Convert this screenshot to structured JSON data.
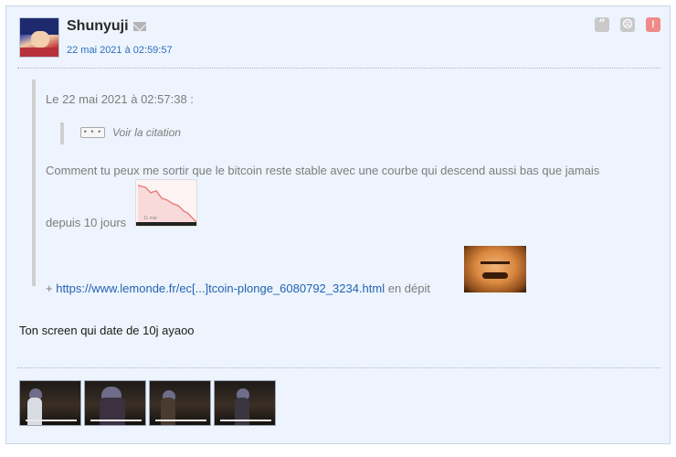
{
  "post": {
    "author": "Shunyuji",
    "date": "22 mai 2021 à 02:59:57",
    "actions": [
      "quote-icon",
      "sad-face-icon",
      "alert-icon"
    ],
    "quote": {
      "header": "Le 22 mai 2021 à 02:57:38 :",
      "nested_toggle": "• • •",
      "nested_label": "Voir la citation",
      "text_line1": "Comment tu peux me sortir que le bitcoin reste stable avec une courbe qui descend aussi bas que jamais",
      "text_line2": "depuis 10 jours",
      "chart_tick": "11 mai",
      "link_prefix": "+",
      "link_text": "https://www.lemonde.fr/ec[...]tcoin-plonge_6080792_3234.html",
      "link_suffix": "en dépit"
    },
    "reply": "Ton screen qui date de 10j ayaoo",
    "attachments": 4
  },
  "colors": {
    "background": "#edf4fd",
    "link": "#2463b3",
    "date": "#2f6fbf",
    "alert": "#f08a8a"
  }
}
